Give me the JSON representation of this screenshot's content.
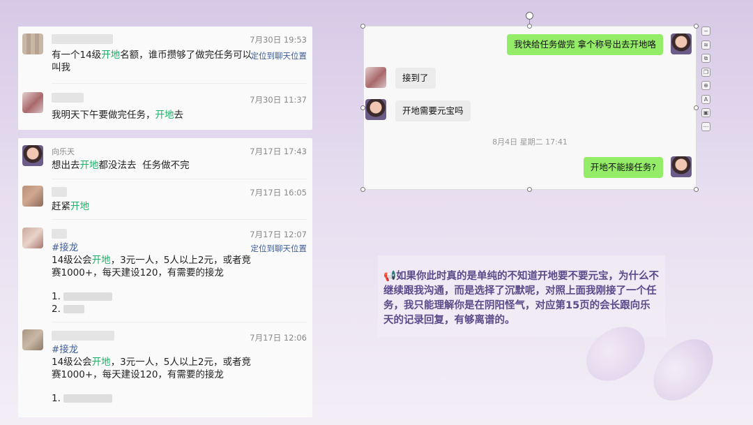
{
  "panel1": {
    "messages": [
      {
        "time": "7月30日 19:53",
        "text_pre": "有一个14级",
        "text_hl": "开地",
        "text_post": "名额，谁币攒够了做完任务可以叫我",
        "locate": "定位到聊天位置"
      },
      {
        "time": "7月30日 11:37",
        "text_pre": "我明天下午要做完任务，",
        "text_hl": "开地",
        "text_post": "去"
      }
    ]
  },
  "panel2": {
    "messages": [
      {
        "name": "向乐天",
        "time": "7月17日 17:43",
        "text_pre": "想出去",
        "text_hl": "开地",
        "text_post": "都没法去  任务做不完"
      },
      {
        "time": "7月17日 16:05",
        "text_pre": "赶紧",
        "text_hl": "开地",
        "text_post": ""
      },
      {
        "time": "7月17日 12:07",
        "tag": "#接龙",
        "locate": "定位到聊天位置",
        "line1_pre": "14级公会",
        "line1_hl": "开地",
        "line1_post": "，3元一人，5人以上2元，或者竞",
        "line2": "赛1000+，每天建设120，有需要的接龙",
        "item1": "1.",
        "item2": "2."
      },
      {
        "time": "7月17日 12:06",
        "tag": "#接龙",
        "line1_pre": "14级公会",
        "line1_hl": "开地",
        "line1_post": "，3元一人，5人以上2元，或者竞",
        "line2": "赛1000+，每天建设120，有需要的接龙",
        "item1": "1."
      }
    ]
  },
  "chat": {
    "msg1": "我快给任务做完 拿个称号出去开地咯",
    "msg2": "接到了",
    "msg3": "开地需要元宝吗",
    "date": "8月4日 星期二 17:41",
    "msg4": "开地不能接任务?"
  },
  "toolbar": {
    "icons": [
      "minus-icon",
      "layers-icon",
      "crop-icon",
      "copy-icon",
      "zoom-icon",
      "text-recognize-icon",
      "image-icon",
      "more-icon"
    ],
    "glyphs": [
      "−",
      "≋",
      "⧉",
      "❐",
      "⊕",
      "A",
      "▣",
      "⋯"
    ]
  },
  "note": {
    "icon": "📢",
    "text": "如果你此时真的是单纯的不知道开地要不要元宝，为什么不继续跟我沟通，而是选择了沉默呢，对照上面我刚接了一个任务，我只能理解你是在阴阳怪气，对应第15页的会长跟向乐天的记录回复，有够离谱的。"
  },
  "colors": {
    "highlight": "#19b266",
    "link": "#3f5d9c",
    "bubble_green": "#95ec69",
    "note_text": "#5b4a8a"
  }
}
